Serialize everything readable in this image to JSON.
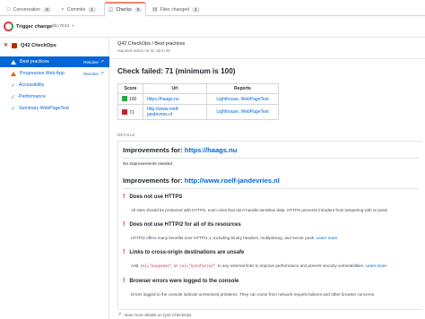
{
  "tabs": [
    {
      "icon": "conversation-icon",
      "label": "Conversation",
      "count": "9"
    },
    {
      "icon": "commits-icon",
      "label": "Commits",
      "count": "1"
    },
    {
      "icon": "checks-icon",
      "label": "Checks",
      "count": "0"
    },
    {
      "icon": "files-icon",
      "label": "Files changed",
      "count": "1"
    }
  ],
  "subheader": {
    "title": "Trigger change",
    "sha": "8bc7534 ▾"
  },
  "sidebar": {
    "suite_name": "Q42 CheckOps",
    "items": [
      {
        "label": "Best practices",
        "status": "warning",
        "resolve": "Resolve"
      },
      {
        "label": "Progressive Web App",
        "status": "warning",
        "resolve": "Resolve"
      },
      {
        "label": "Accessibility",
        "status": "success",
        "resolve": ""
      },
      {
        "label": "Performance",
        "status": "success",
        "resolve": ""
      },
      {
        "label": "Summary WebPageTest",
        "status": "success",
        "resolve": ""
      }
    ]
  },
  "main": {
    "run_title": "Q42 CheckOps / Best practices",
    "run_subtitle": "required action on 22 Jul in 0s",
    "fail_heading": "Check failed: 71 (minimum is 100)",
    "table": {
      "headers": [
        "Score",
        "Url",
        "Reports"
      ],
      "rows": [
        {
          "score": "100",
          "color": "#28a745",
          "url": "https://haags.nu",
          "reports": "Lighthouse, WebPageTest"
        },
        {
          "score": "71",
          "color": "#cb2431",
          "url": "http://www.roelf-jandevries.nl",
          "reports": "Lighthouse, WebPageTest"
        }
      ]
    },
    "details_label": "DETAILS",
    "improvements": [
      {
        "prefix": "Improvements for: ",
        "url": "https://haags.nu"
      },
      {
        "prefix": "Improvements for: ",
        "url": "http://www.roelf-jandevries.nl"
      }
    ],
    "no_improvements": "No improvements needed",
    "audits": [
      {
        "title": "Does not use HTTPS",
        "desc": "All sites should be protected with HTTPS, even ones that don't handle sensitive data. HTTPS prevents intruders from tampering with or passi",
        "link": ""
      },
      {
        "title": "Does not use HTTP/2 for all of its resources",
        "desc": "HTTP/2 offers many benefits over HTTP/1.1, including binary headers, multiplexing, and server push. ",
        "link": "Learn more."
      },
      {
        "title": "Links to cross-origin destinations are unsafe",
        "desc_code1": "rel=\"noopener\"",
        "desc_mid": " or ",
        "desc_code2": "rel=\"noreferrer\"",
        "desc": " to any external links to improve performance and prevent security vulnerabilities. ",
        "desc_prefix": "Add ",
        "link": "Learn more."
      },
      {
        "title": "Browser errors were logged to the console",
        "desc": "Errors logged to the console indicate unresolved problems. They can come from network request failures and other browser concerns.",
        "link": ""
      }
    ],
    "footer_link": "View more details on Q42 CheckOps"
  }
}
